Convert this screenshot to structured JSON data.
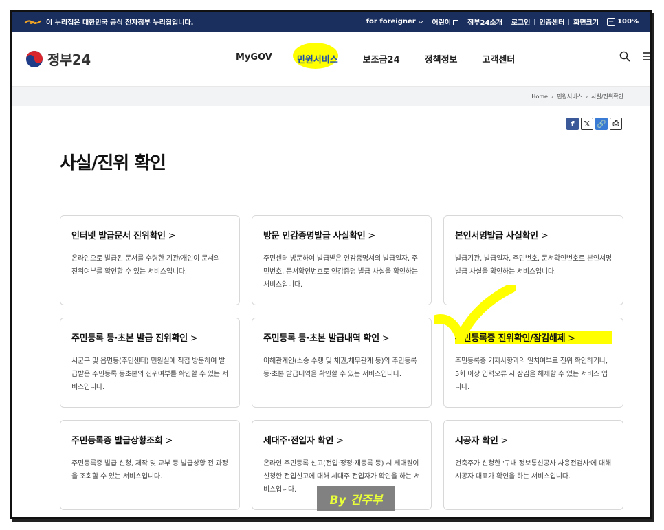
{
  "banner": {
    "notice": "이 누리집은 대한민국 공식 전자정부 누리집입니다.",
    "utils": [
      "for foreigner",
      "어린이",
      "정부24소개",
      "로그인",
      "인증센터",
      "화면크기",
      "100%"
    ]
  },
  "header": {
    "logo_text": "정부24",
    "nav": [
      "MyGOV",
      "민원서비스",
      "보조금24",
      "정책정보",
      "고객센터"
    ],
    "active_nav": "민원서비스"
  },
  "breadcrumb": [
    "Home",
    "민원서비스",
    "사실/진위확인"
  ],
  "share_icons": [
    "facebook-icon",
    "x-icon",
    "link-icon",
    "print-icon"
  ],
  "page_title": "사실/진위 확인",
  "cards": [
    {
      "title": "인터넷 발급문서 진위확인",
      "desc": "온라인으로 발급된 문서를 수령한 기관/개인이 문서의 진위여부를 확인할 수 있는 서비스입니다."
    },
    {
      "title": "방문 인감증명발급 사실확인",
      "desc": "주민센터 방문하여 발급받은 인감증명서의 발급일자, 주민번호, 문서확인번호로 인감증명 발급 사실을 확인하는 서비스입니다."
    },
    {
      "title": "본인서명발급 사실확인",
      "desc": "발급기관, 발급일자, 주민번호, 문서확인번호로 본인서명 발급 사실을 확인하는 서비스입니다."
    },
    {
      "title": "주민등록 등·초본 발급 진위확인",
      "desc": "시군구 및 읍면동(주민센터) 민원실에 직접 방문하여 발급받은 주민등록 등초본의 진위여부를 확인할 수 있는 서비스입니다."
    },
    {
      "title": "주민등록 등·초본 발급내역 확인",
      "desc": "이해관계인(소송 수행 및 채권,채무관계 등)의 주민등록 등·초본 발급내역을 확인할 수 있는 서비스입니다."
    },
    {
      "title": "주민등록증 진위확인/잠김해제",
      "desc": "주민등록증 기재사항과의 일치여부로 진위 확인하거나, 5회 이상 입력오류 시 잠김을 해제할 수 있는 서비스 입니다."
    },
    {
      "title": "주민등록증 발급상황조회",
      "desc": "주민등록증 발급 신청, 제작 및 교부 등 발급상황 전 과정을 조회할 수 있는 서비스입니다."
    },
    {
      "title": "세대주·전입자 확인",
      "desc": "온라인 주민등록 신고(전입·정정·재등록 등) 시 세대원이 신청한 전입신고에 대해 세대주·전입자가 확인을 하는 서비스입니다."
    },
    {
      "title": "시공자 확인",
      "desc": "건축주가 신청한 '구내 정보통신공사 사용전검사'에 대해 시공자 대표가 확인을 하는 서비스입니다."
    }
  ],
  "highlighted_card": "주민등록증 진위확인/잠김해제",
  "watermark": "By 건주부",
  "colors": {
    "banner_bg": "#1a2f5e",
    "highlight": "#ffff00",
    "accent": "#1e4fa8"
  }
}
